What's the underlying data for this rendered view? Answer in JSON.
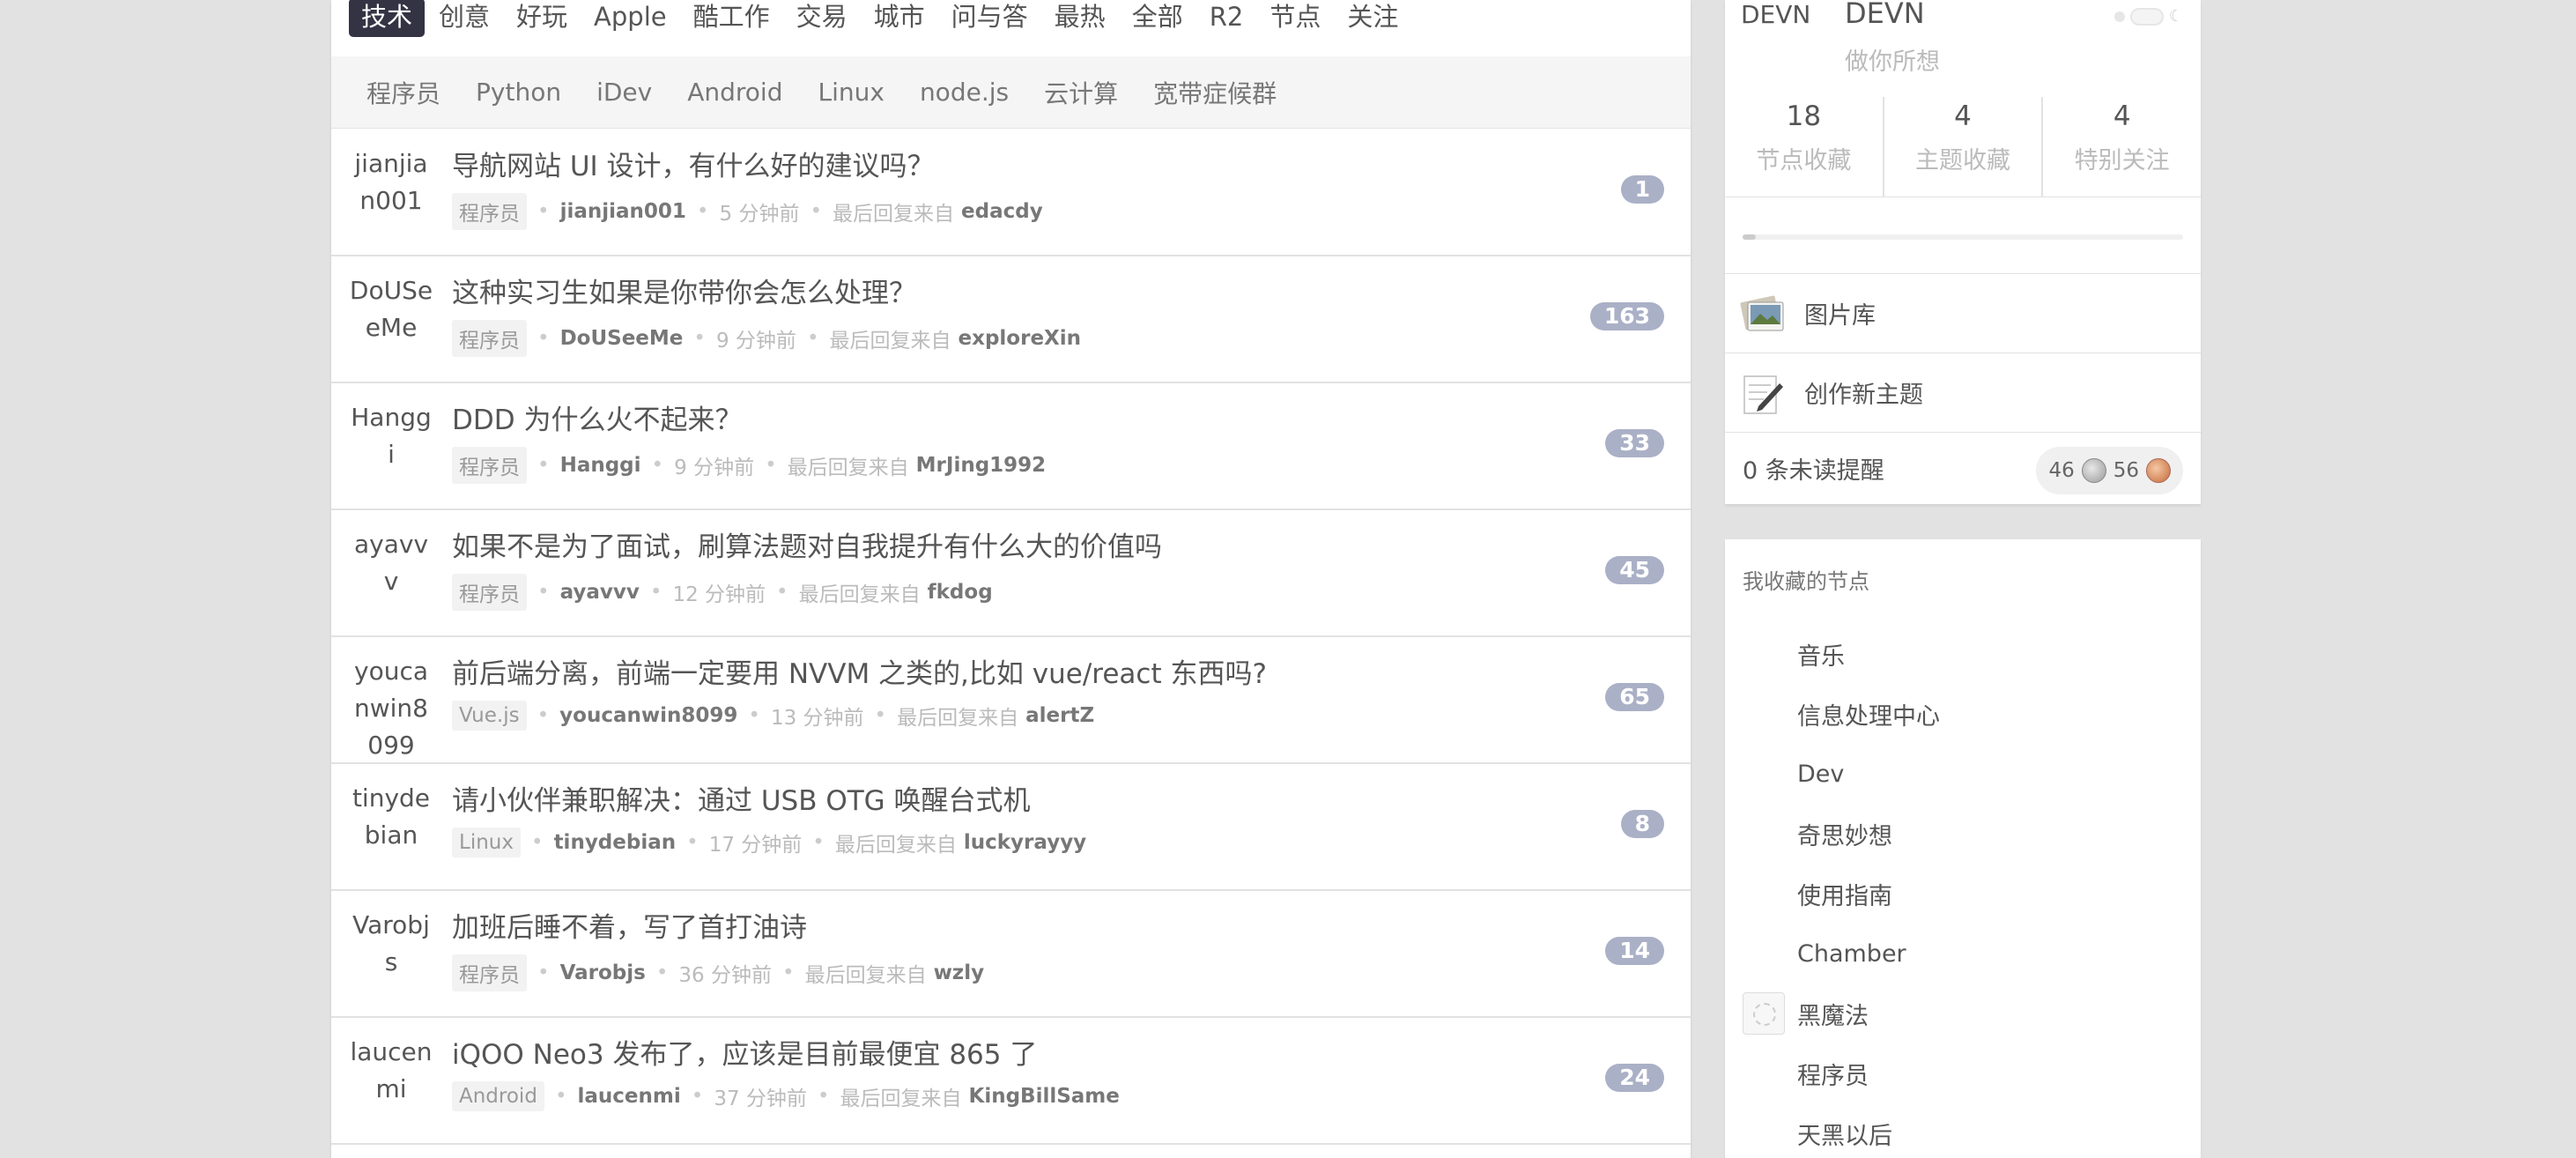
{
  "tabs": [
    {
      "label": "技术",
      "current": true
    },
    {
      "label": "创意"
    },
    {
      "label": "好玩"
    },
    {
      "label": "Apple"
    },
    {
      "label": "酷工作"
    },
    {
      "label": "交易"
    },
    {
      "label": "城市"
    },
    {
      "label": "问与答"
    },
    {
      "label": "最热"
    },
    {
      "label": "全部"
    },
    {
      "label": "R2"
    },
    {
      "label": "节点"
    },
    {
      "label": "关注"
    }
  ],
  "subtabs": [
    "程序员",
    "Python",
    "iDev",
    "Android",
    "Linux",
    "node.js",
    "云计算",
    "宽带症候群"
  ],
  "topics": [
    {
      "avatar_alt": "jianjian001",
      "title": "导航网站 UI 设计，有什么好的建议吗？",
      "node": "程序员",
      "author": "jianjian001",
      "time": "5 分钟前",
      "last_reply_prefix": "最后回复来自",
      "last_reply_user": "edacdy",
      "replies": "1"
    },
    {
      "avatar_alt": "DoUSeeMe",
      "title": "这种实习生如果是你带你会怎么处理？",
      "node": "程序员",
      "author": "DoUSeeMe",
      "time": "9 分钟前",
      "last_reply_prefix": "最后回复来自",
      "last_reply_user": "exploreXin",
      "replies": "163"
    },
    {
      "avatar_alt": "Hanggi",
      "title": "DDD 为什么火不起来？",
      "node": "程序员",
      "author": "Hanggi",
      "time": "9 分钟前",
      "last_reply_prefix": "最后回复来自",
      "last_reply_user": "MrJing1992",
      "replies": "33"
    },
    {
      "avatar_alt": "ayavvv",
      "title": "如果不是为了面试，刷算法题对自我提升有什么大的价值吗",
      "node": "程序员",
      "author": "ayavvv",
      "time": "12 分钟前",
      "last_reply_prefix": "最后回复来自",
      "last_reply_user": "fkdog",
      "replies": "45"
    },
    {
      "avatar_alt": "youcanwin8099",
      "title": "前后端分离，前端一定要用 NVVM 之类的,比如 vue/react 东西吗?",
      "node": "Vue.js",
      "author": "youcanwin8099",
      "time": "13 分钟前",
      "last_reply_prefix": "最后回复来自",
      "last_reply_user": "alertZ",
      "replies": "65"
    },
    {
      "avatar_alt": "tinydebian",
      "title": "请小伙伴兼职解决：通过 USB OTG 唤醒台式机",
      "node": "Linux",
      "author": "tinydebian",
      "time": "17 分钟前",
      "last_reply_prefix": "最后回复来自",
      "last_reply_user": "luckyrayyy",
      "replies": "8"
    },
    {
      "avatar_alt": "Varobjs",
      "title": "加班后睡不着，写了首打油诗",
      "node": "程序员",
      "author": "Varobjs",
      "time": "36 分钟前",
      "last_reply_prefix": "最后回复来自",
      "last_reply_user": "wzly",
      "replies": "14"
    },
    {
      "avatar_alt": "laucenmi",
      "title": "iQOO Neo3 发布了，应该是目前最便宜 865 了",
      "node": "Android",
      "author": "laucenmi",
      "time": "37 分钟前",
      "last_reply_prefix": "最后回复来自",
      "last_reply_user": "KingBillSame",
      "replies": "24"
    }
  ],
  "profile": {
    "avatar_alt": "DEVN",
    "username": "DEVN",
    "tagline": "做你所想",
    "stats": [
      {
        "num": "18",
        "label": "节点收藏"
      },
      {
        "num": "4",
        "label": "主题收藏"
      },
      {
        "num": "4",
        "label": "特别关注"
      }
    ],
    "progress": 0.03,
    "gallery_label": "图片库",
    "new_topic_label": "创作新主题",
    "notifications": "0 条未读提醒",
    "silver": "46",
    "bronze": "56"
  },
  "favorite_nodes": {
    "title": "我收藏的节点",
    "items": [
      "音乐",
      "信息处理中心",
      "Dev",
      "奇思妙想",
      "使用指南",
      "Chamber",
      "黑魔法",
      "程序员",
      "天黑以后"
    ]
  }
}
